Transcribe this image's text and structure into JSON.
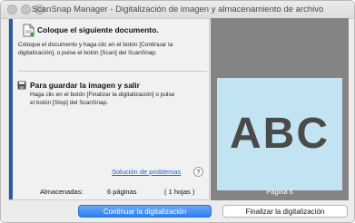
{
  "window": {
    "title": "ScanSnap Manager - Digitalización de imagen y almacenamiento de archivo"
  },
  "steps": [
    {
      "title": "Coloque el siguiente documento.",
      "text_line1": "Coloque el documento y haga clic en el botón [Continuar la",
      "text_line2": "digitalización], o pulse el botón [Scan] del ScanSnap."
    },
    {
      "title": "Para guardar la imagen y salir",
      "text_line1": "Haga clic en el botón [Finalizar la digitalización] o pulse",
      "text_line2": "el botón [Stop] del ScanSnap."
    }
  ],
  "help": {
    "link_label": "Solución de problemas",
    "icon_glyph": "?"
  },
  "stats": {
    "label": "Almacenadas:",
    "pages": "6 páginas",
    "sheets": "( 1 hojas )"
  },
  "preview": {
    "page_text": "ABC",
    "page_label": "Página 6"
  },
  "buttons": {
    "continue_label": "Continuar la digitalización",
    "finish_label": "Finalizar la digitalización"
  },
  "colors": {
    "accent": "#2f5aa0",
    "link": "#1d64d8",
    "primary_button": "#2f80ed",
    "preview_background": "#848484",
    "page_background": "#c2e4f2"
  },
  "icons": [
    "document-icon",
    "save-icon",
    "help-icon"
  ]
}
